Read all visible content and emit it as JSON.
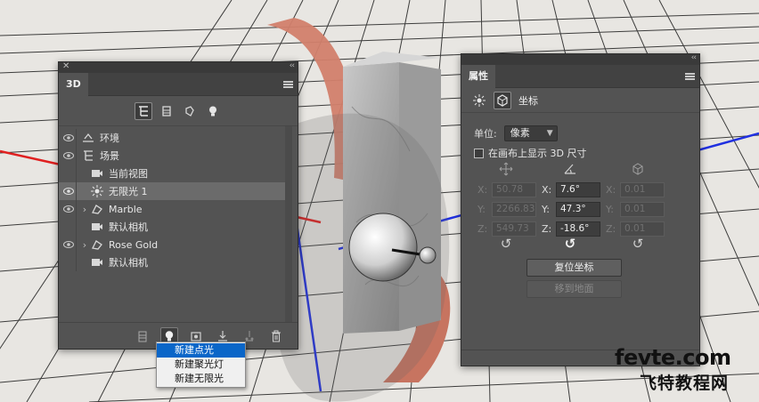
{
  "panel_3d": {
    "tab_label": "3D",
    "layers": [
      {
        "label": "环境",
        "eye": true,
        "chevron": false,
        "icon": "environment-icon"
      },
      {
        "label": "场景",
        "eye": true,
        "chevron": false,
        "icon": "scene-icon"
      },
      {
        "label": "当前视图",
        "eye": false,
        "chevron": false,
        "icon": "camera-icon"
      },
      {
        "label": "无限光 1",
        "eye": true,
        "chevron": false,
        "icon": "infinite-light-icon",
        "selected": true
      },
      {
        "label": "Marble",
        "eye": true,
        "chevron": true,
        "icon": "mesh-icon"
      },
      {
        "label": "默认相机",
        "eye": false,
        "chevron": false,
        "icon": "camera-icon"
      },
      {
        "label": "Rose Gold",
        "eye": true,
        "chevron": true,
        "icon": "mesh-icon"
      },
      {
        "label": "默认相机",
        "eye": false,
        "chevron": false,
        "icon": "camera-icon"
      }
    ],
    "light_menu": [
      "新建点光",
      "新建聚光灯",
      "新建无限光"
    ]
  },
  "panel_props": {
    "tab_label": "属性",
    "section_title": "坐标",
    "unit_label": "单位:",
    "unit_value": "像素",
    "checkbox_label": "在画布上显示 3D 尺寸",
    "position": {
      "x": "50.78",
      "y": "2266.83",
      "z": "549.73"
    },
    "rotation": {
      "x": "7.6°",
      "y": "47.3°",
      "z": "-18.6°"
    },
    "scale": {
      "x": "0.01",
      "y": "0.01",
      "z": "0.01"
    },
    "axis_labels": {
      "x": "X:",
      "y": "Y:",
      "z": "Z:"
    },
    "reset_button": "复位坐标",
    "move_to_ground_button": "移到地面"
  },
  "watermark": {
    "line1": "fevte.com",
    "line2": "飞特教程网"
  },
  "colors": {
    "panel_bg": "#535353",
    "highlight": "#0a66c8",
    "rose_gold": "#d2806b",
    "axis_red": "#e02020",
    "axis_blue": "#2030e0"
  }
}
